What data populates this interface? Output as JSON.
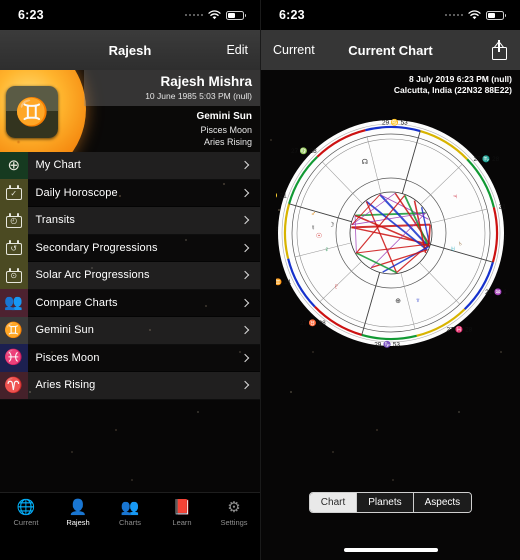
{
  "status_bar": {
    "time": "6:23",
    "wifi_icon": "wifi-icon",
    "battery_icon": "battery-icon"
  },
  "left": {
    "nav": {
      "title": "Rajesh",
      "edit_label": "Edit"
    },
    "profile": {
      "avatar_glyph": "♊",
      "avatar_sign": "gemini-glyph",
      "name": "Rajesh Mishra",
      "birth": "10 June 1985 5:03 PM (null)",
      "sun": "Gemini Sun",
      "moon": "Pisces Moon",
      "rising": "Aries Rising"
    },
    "menu": [
      {
        "label": "My Chart",
        "icon": "wheel-icon",
        "glyph": "⊕",
        "tile": "#163a20"
      },
      {
        "label": "Daily Horoscope",
        "icon": "calendar-check-icon",
        "glyph": "✓",
        "tile": "#4b4a22"
      },
      {
        "label": "Transits",
        "icon": "calendar-clock-icon",
        "glyph": "◴",
        "tile": "#4b4a22"
      },
      {
        "label": "Secondary Progressions",
        "icon": "calendar-refresh-icon",
        "glyph": "↺",
        "tile": "#4b4a22"
      },
      {
        "label": "Solar Arc Progressions",
        "icon": "calendar-sun-icon",
        "glyph": "⊙",
        "tile": "#4b4a22"
      },
      {
        "label": "Compare Charts",
        "icon": "two-people-icon",
        "glyph": "👥",
        "tile": "#4d2230"
      },
      {
        "label": "Gemini Sun",
        "icon": "gemini-icon",
        "glyph": "♊",
        "tile": "#3a3a3a"
      },
      {
        "label": "Pisces Moon",
        "icon": "pisces-icon",
        "glyph": "♓",
        "tile": "#1c2050"
      },
      {
        "label": "Aries Rising",
        "icon": "aries-icon",
        "glyph": "♈",
        "tile": "#45212a"
      }
    ],
    "tabs": [
      {
        "label": "Current",
        "icon": "globe-icon",
        "glyph": "🌐",
        "active": false
      },
      {
        "label": "Rajesh",
        "icon": "person-icon",
        "glyph": "👤",
        "active": true
      },
      {
        "label": "Charts",
        "icon": "group-icon",
        "glyph": "👥",
        "active": false
      },
      {
        "label": "Learn",
        "icon": "book-icon",
        "glyph": "📕",
        "active": false
      },
      {
        "label": "Settings",
        "icon": "gear-icon",
        "glyph": "⚙",
        "active": false
      }
    ]
  },
  "right": {
    "nav": {
      "back_label": "Current",
      "title": "Current Chart",
      "share_icon": "share-icon"
    },
    "meta": {
      "line1": "8 July 2019 6:23 PM (null)",
      "line2": "Calcutta, India   (22N32 88E22)"
    },
    "segments": [
      {
        "label": "Chart",
        "selected": true
      },
      {
        "label": "Planets",
        "selected": false
      },
      {
        "label": "Aspects",
        "selected": false
      }
    ],
    "chart": {
      "type": "natal-wheel",
      "angles": [
        {
          "name": "Ascendant",
          "label": "16 ♎ 34",
          "degree": 16,
          "sign": "Libra"
        },
        {
          "name": "Descendant",
          "label": "16 ♈ 34",
          "degree": 16,
          "sign": "Aries"
        },
        {
          "name": "Midheaven",
          "label": "29 ♋ 53",
          "degree": 29,
          "sign": "Cancer"
        },
        {
          "name": "Imum Coeli",
          "label": "29 ♑ 53",
          "degree": 29,
          "sign": "Capricorn"
        }
      ],
      "cusps": [
        {
          "label": "27 ♏ 28",
          "sign": "Scorpio"
        },
        {
          "label": "21 ♐ 21",
          "sign": "Sagittarius"
        },
        {
          "label": "21 ♒ 21",
          "sign": "Aquarius"
        },
        {
          "label": "27 ♓ 28",
          "sign": "Pisces"
        },
        {
          "label": "27 ♍ 28",
          "sign": "Virgo"
        },
        {
          "label": "21 ♌ 21",
          "sign": "Leo"
        },
        {
          "label": "21 ♊ 21",
          "sign": "Gemini"
        },
        {
          "label": "27 ♉ 28",
          "sign": "Taurus"
        }
      ],
      "aspect_line_colors": [
        "#cc1111",
        "#1531cc",
        "#119933",
        "#9b36b5"
      ],
      "ring_colors": [
        "#119933",
        "#cc1111",
        "#1531cc",
        "#d8b400"
      ]
    }
  }
}
